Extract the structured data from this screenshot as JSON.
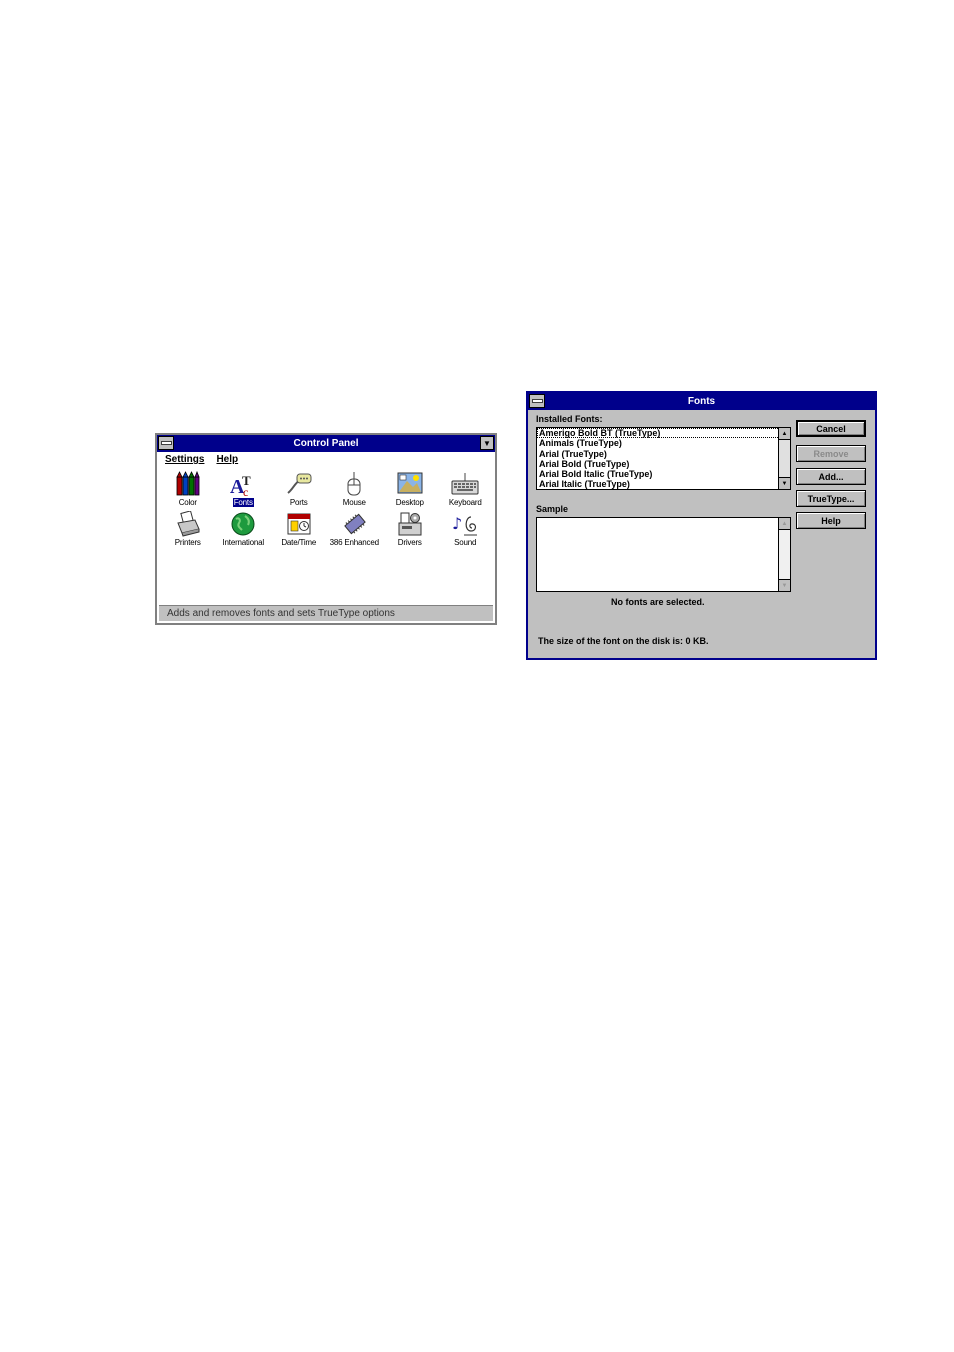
{
  "control_panel": {
    "title": "Control Panel",
    "menu": [
      "Settings",
      "Help"
    ],
    "icons": [
      {
        "label": "Color",
        "icon": "color-crayons-icon"
      },
      {
        "label": "Fonts",
        "icon": "fonts-icon"
      },
      {
        "label": "Ports",
        "icon": "ports-icon"
      },
      {
        "label": "Mouse",
        "icon": "mouse-icon"
      },
      {
        "label": "Desktop",
        "icon": "desktop-icon"
      },
      {
        "label": "Keyboard",
        "icon": "keyboard-icon"
      },
      {
        "label": "Printers",
        "icon": "printers-icon"
      },
      {
        "label": "International",
        "icon": "globe-icon"
      },
      {
        "label": "Date/Time",
        "icon": "date-time-icon"
      },
      {
        "label": "386 Enhanced",
        "icon": "chip-icon"
      },
      {
        "label": "Drivers",
        "icon": "drivers-icon"
      },
      {
        "label": "Sound",
        "icon": "sound-icon"
      }
    ],
    "selected_icon": "Fonts",
    "status": "Adds and removes fonts and sets TrueType options"
  },
  "fonts_dialog": {
    "title": "Fonts",
    "installed_label": "Installed Fonts:",
    "installed_fonts": [
      "Amerigo Bold BT (TrueType)",
      "Animals (TrueType)",
      "Arial (TrueType)",
      "Arial Bold (TrueType)",
      "Arial Bold Italic (TrueType)",
      "Arial Italic (TrueType)"
    ],
    "sample_label": "Sample",
    "no_fonts_text": "No fonts are selected.",
    "size_text": "The size of the font on the disk is:  0 KB.",
    "buttons": {
      "cancel": "Cancel",
      "remove": "Remove",
      "add": "Add...",
      "truetype": "TrueType...",
      "help": "Help"
    }
  },
  "colors": {
    "titlebar": "#00008b",
    "window_face": "#c0c0c0"
  }
}
